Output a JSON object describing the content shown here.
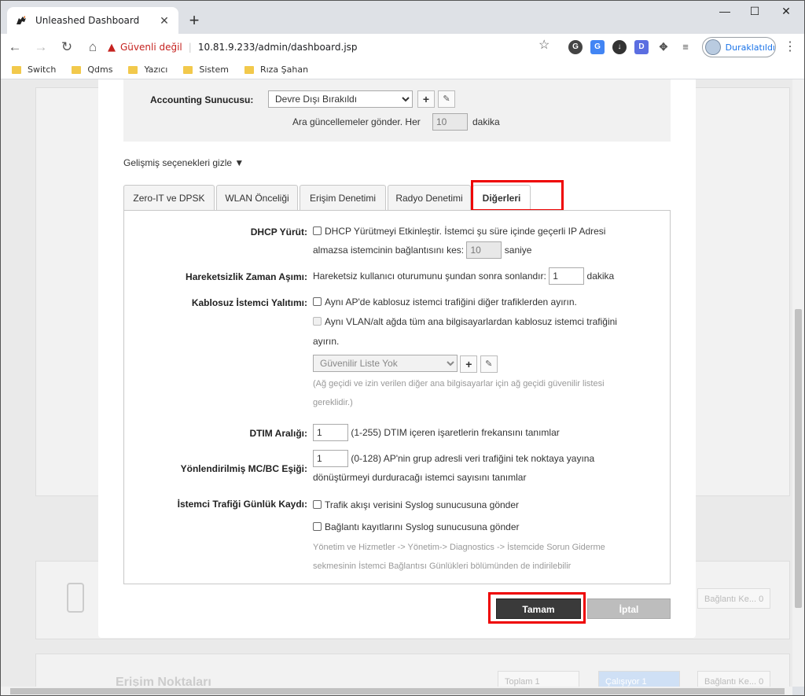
{
  "browser": {
    "tab_title": "Unleashed Dashboard",
    "new_tab": "+",
    "min": "—",
    "max": "☐",
    "close": "✕",
    "insecure": "Güvenli değil",
    "url": "10.81.9.233/admin/dashboard.jsp",
    "profile": "Duraklatıldı",
    "bookmarks": [
      "Switch",
      "Qdms",
      "Yazıcı",
      "Sistem",
      "Rıza Şahan"
    ]
  },
  "accounting": {
    "label": "Accounting Sunucusu:",
    "selected": "Devre Dışı Bırakıldı",
    "interim_prefix": "Ara güncellemeler gönder. Her",
    "interim_value": "10",
    "interim_suffix": "dakika"
  },
  "advanced_toggle": "Gelişmiş seçenekleri gizle ▼",
  "tabs": [
    "Zero-IT ve DPSK",
    "WLAN Önceliği",
    "Erişim Denetimi",
    "Radyo Denetimi",
    "Diğerleri"
  ],
  "active_tab": "Diğerleri",
  "form": {
    "dhcp_label": "DHCP Yürüt:",
    "dhcp_text1": "DHCP Yürütmeyi Etkinleştir. İstemci şu süre içinde geçerli IP Adresi",
    "dhcp_text2": "almazsa istemcinin bağlantısını kes:",
    "dhcp_value": "10",
    "dhcp_unit": "saniye",
    "idle_label": "Hareketsizlik Zaman Aşımı:",
    "idle_text": "Hareketsiz kullanıcı oturumunu şundan sonra sonlandır:",
    "idle_value": "1",
    "idle_unit": "dakika",
    "iso_label": "Kablosuz İstemci Yalıtımı:",
    "iso_opt1": "Aynı AP'de kablosuz istemci trafiğini diğer trafiklerden ayırın.",
    "iso_opt2a": "Aynı VLAN/alt ağda tüm ana bilgisayarlardan kablosuz istemci trafiğini",
    "iso_opt2b": "ayırın.",
    "whitelist_selected": "Güvenilir Liste Yok",
    "whitelist_note1": "(Ağ geçidi ve izin verilen diğer ana bilgisayarlar için ağ geçidi güvenilir listesi",
    "whitelist_note2": "gereklidir.)",
    "dtim_label": "DTIM Aralığı:",
    "dtim_value": "1",
    "dtim_text": "(1-255) DTIM içeren işaretlerin frekansını tanımlar",
    "mcbc_label": "Yönlendirilmiş MC/BC Eşiği:",
    "mcbc_value": "1",
    "mcbc_text1": "(0-128) AP'nin grup adresli veri trafiğini tek noktaya yayına",
    "mcbc_text2": "dönüştürmeyi durduracağı istemci sayısını tanımlar",
    "log_label": "İstemci Trafiği Günlük Kaydı:",
    "log_opt1": "Trafik akışı verisini Syslog sunucusuna gönder",
    "log_opt2": "Bağlantı kayıtlarını Syslog sunucusuna gönder",
    "log_note1": "Yönetim ve Hizmetler -> Yönetim-> Diagnostics -> İstemcide Sorun Giderme",
    "log_note2": "sekmesinin İstemci Bağlantısı Günlükleri bölümünden de indirilebilir"
  },
  "buttons": {
    "ok": "Tamam",
    "cancel": "İptal"
  },
  "background": {
    "conn1": "Bağlantı Ke... 0",
    "ap_title": "Erişim Noktaları",
    "total": "Toplam   1",
    "running": "Çalışıyor   1",
    "conn2": "Bağlantı Ke... 0"
  },
  "colors": {
    "highlight": "#e00000",
    "insecure": "#c5221f"
  }
}
